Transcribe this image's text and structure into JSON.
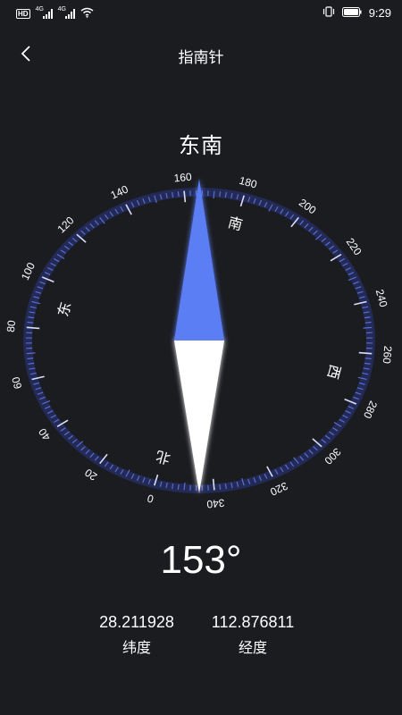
{
  "status_bar": {
    "left_badges": [
      "HD",
      "4G",
      "4G"
    ],
    "time": "9:29",
    "icons": [
      "hd-icon",
      "signal-icon",
      "signal-icon",
      "wifi-icon",
      "vibrate-icon",
      "battery-icon"
    ]
  },
  "header": {
    "title": "指南针",
    "back_icon": "chevron-left-icon"
  },
  "compass": {
    "direction": "东南",
    "heading_display": "153°",
    "heading_degrees": 153,
    "dial_numbers": [
      "0",
      "20",
      "40",
      "60",
      "80",
      "100",
      "120",
      "140",
      "160",
      "180",
      "200",
      "220",
      "240",
      "260",
      "280",
      "300",
      "320",
      "340"
    ],
    "cardinals": {
      "north": "北",
      "east": "东",
      "south": "南",
      "west": "西"
    },
    "colors": {
      "ring": "#5b6dd1",
      "needle_north": "#5b7ef5",
      "needle_south": "#ffffff",
      "background": "#1b1c20"
    }
  },
  "location": {
    "latitude": "28.211928",
    "latitude_label": "纬度",
    "longitude": "112.876811",
    "longitude_label": "经度"
  }
}
